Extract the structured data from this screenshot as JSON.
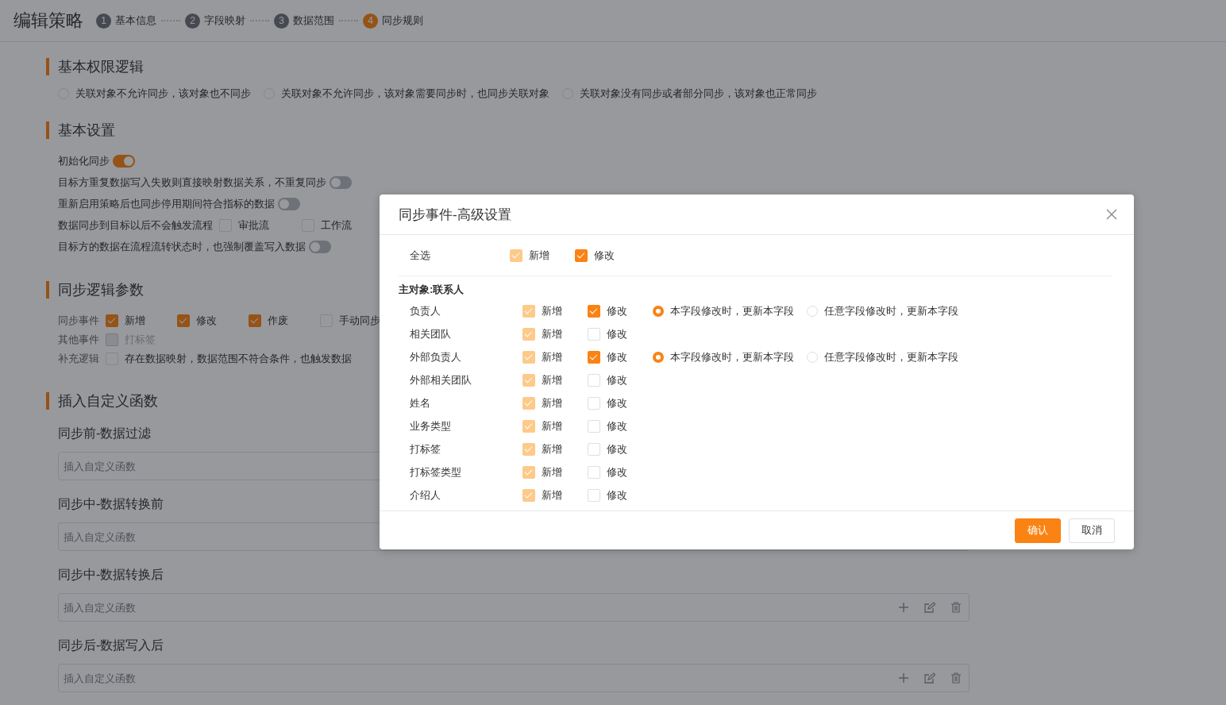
{
  "header": {
    "title": "编辑策略",
    "steps": [
      {
        "number": "1",
        "label": "基本信息",
        "selected": false
      },
      {
        "number": "2",
        "label": "字段映射",
        "selected": false
      },
      {
        "number": "3",
        "label": "数据范围",
        "selected": false
      },
      {
        "number": "4",
        "label": "同步规则",
        "selected": true
      }
    ]
  },
  "sections": [
    {
      "kind": "radios",
      "title": "基本权限逻辑",
      "options": [
        {
          "label": "关联对象不允许同步，该对象也不同步",
          "selected": false
        },
        {
          "label": "关联对象不允许同步，该对象需要同步时，也同步关联对象",
          "selected": false
        },
        {
          "label": "关联对象没有同步或者部分同步，该对象也正常同步",
          "selected": false
        }
      ]
    },
    {
      "kind": "settings",
      "title": "基本设置",
      "rows": [
        {
          "kind": "toggle",
          "label": "初始化同步",
          "on": true
        },
        {
          "kind": "toggle",
          "label": "目标方重复数据写入失败则直接映射数据关系，不重复同步",
          "on": false
        },
        {
          "kind": "toggle",
          "label": "重新启用策略后也同步停用期间符合指标的数据",
          "on": false
        },
        {
          "kind": "checks",
          "label": "数据同步到目标以后不会触发流程",
          "options": [
            {
              "label": "审批流",
              "checked": false,
              "disabled": false
            },
            {
              "label": "工作流",
              "checked": false,
              "disabled": false
            }
          ]
        },
        {
          "kind": "toggle",
          "label": "目标方的数据在流程流转状态时，也强制覆盖写入数据",
          "on": false
        }
      ]
    },
    {
      "kind": "params",
      "title": "同步逻辑参数",
      "rows": [
        {
          "label": "同步事件",
          "options": [
            {
              "label": "新增",
              "checked": true,
              "disabled": false
            },
            {
              "label": "修改",
              "checked": true,
              "disabled": false
            },
            {
              "label": "作废",
              "checked": true,
              "disabled": false
            },
            {
              "label": "手动同步",
              "checked": false,
              "disabled": false
            }
          ]
        },
        {
          "label": "其他事件",
          "options": [
            {
              "label": "打标签",
              "checked": false,
              "disabled": true
            }
          ]
        },
        {
          "label": "补充逻辑",
          "options": [
            {
              "label": "存在数据映射，数据范围不符合条件，也触发数据",
              "checked": false,
              "disabled": false
            }
          ]
        }
      ]
    },
    {
      "kind": "functions",
      "title": "插入自定义函数",
      "fields": [
        {
          "label": "同步前-数据过滤",
          "placeholder": "插入自定义函数"
        },
        {
          "label": "同步中-数据转换前",
          "placeholder": "插入自定义函数"
        },
        {
          "label": "同步中-数据转换后",
          "placeholder": "插入自定义函数",
          "actions": true
        },
        {
          "label": "同步后-数据写入后",
          "placeholder": "插入自定义函数",
          "actions": true
        }
      ]
    }
  ],
  "modal": {
    "title": "同步事件-高级设置",
    "select_all": {
      "label": "全选",
      "options": [
        {
          "label": "新增",
          "checked": true,
          "disabled": true
        },
        {
          "label": "修改",
          "checked": true,
          "disabled": false
        }
      ]
    },
    "group": "主对象:联系人",
    "fields": [
      {
        "name": "负责人",
        "options": [
          {
            "label": "新增",
            "checked": true,
            "disabled": true
          },
          {
            "label": "修改",
            "checked": true,
            "disabled": false
          }
        ],
        "modes": [
          {
            "label": "本字段修改时，更新本字段",
            "selected": true
          },
          {
            "label": "任意字段修改时，更新本字段",
            "selected": false
          }
        ]
      },
      {
        "name": "相关团队",
        "options": [
          {
            "label": "新增",
            "checked": true,
            "disabled": true
          },
          {
            "label": "修改",
            "checked": false,
            "disabled": false
          }
        ]
      },
      {
        "name": "外部负责人",
        "options": [
          {
            "label": "新增",
            "checked": true,
            "disabled": true
          },
          {
            "label": "修改",
            "checked": true,
            "disabled": false
          }
        ],
        "modes": [
          {
            "label": "本字段修改时，更新本字段",
            "selected": true
          },
          {
            "label": "任意字段修改时，更新本字段",
            "selected": false
          }
        ]
      },
      {
        "name": "外部相关团队",
        "options": [
          {
            "label": "新增",
            "checked": true,
            "disabled": true
          },
          {
            "label": "修改",
            "checked": false,
            "disabled": false
          }
        ]
      },
      {
        "name": "姓名",
        "options": [
          {
            "label": "新增",
            "checked": true,
            "disabled": true
          },
          {
            "label": "修改",
            "checked": false,
            "disabled": false
          }
        ]
      },
      {
        "name": "业务类型",
        "options": [
          {
            "label": "新增",
            "checked": true,
            "disabled": true
          },
          {
            "label": "修改",
            "checked": false,
            "disabled": false
          }
        ]
      },
      {
        "name": "打标签",
        "options": [
          {
            "label": "新增",
            "checked": true,
            "disabled": true
          },
          {
            "label": "修改",
            "checked": false,
            "disabled": false
          }
        ]
      },
      {
        "name": "打标签类型",
        "options": [
          {
            "label": "新增",
            "checked": true,
            "disabled": true
          },
          {
            "label": "修改",
            "checked": false,
            "disabled": false
          }
        ]
      },
      {
        "name": "介绍人",
        "options": [
          {
            "label": "新增",
            "checked": true,
            "disabled": true
          },
          {
            "label": "修改",
            "checked": false,
            "disabled": false
          }
        ]
      }
    ],
    "buttons": [
      {
        "label": "确认",
        "kind": "primary"
      },
      {
        "label": "取消",
        "kind": "default"
      }
    ]
  }
}
